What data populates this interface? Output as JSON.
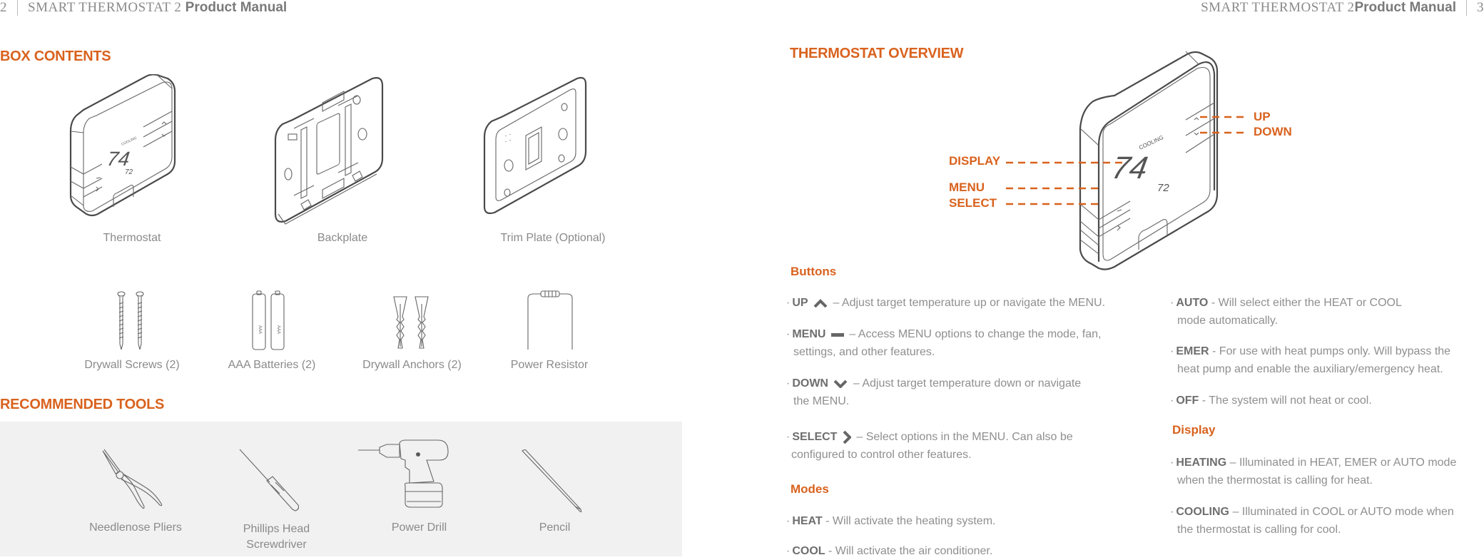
{
  "header_left": {
    "page_number": "2",
    "title_serif": "SMART THERMOSTAT 2",
    "title_bold": "Product Manual"
  },
  "header_right": {
    "title_serif": "SMART THERMOSTAT 2",
    "title_bold": "Product Manual",
    "page_number": "3"
  },
  "box_contents": {
    "title": "BOX CONTENTS",
    "items": [
      {
        "label": "Thermostat",
        "icon": "thermostat-icon"
      },
      {
        "label": "Backplate",
        "icon": "backplate-icon"
      },
      {
        "label": "Trim Plate (Optional)",
        "icon": "trim-plate-icon"
      },
      {
        "label": "Drywall Screws (2)",
        "icon": "screws-icon"
      },
      {
        "label": "AAA Batteries (2)",
        "icon": "batteries-icon"
      },
      {
        "label": "Drywall Anchors (2)",
        "icon": "anchors-icon"
      },
      {
        "label": "Power Resistor",
        "icon": "resistor-icon"
      }
    ],
    "thermostat_display": {
      "mode": "COOLING",
      "target": "74",
      "current": "72"
    },
    "battery_text": "AAA"
  },
  "recommended_tools": {
    "title": "RECOMMENDED TOOLS",
    "items": [
      {
        "label": "Needlenose Pliers",
        "icon": "pliers-icon"
      },
      {
        "label": "Phillips Head",
        "label2": "Screwdriver",
        "icon": "screwdriver-icon"
      },
      {
        "label": "Power Drill",
        "icon": "drill-icon"
      },
      {
        "label": "Pencil",
        "icon": "pencil-icon"
      }
    ]
  },
  "overview": {
    "title": "THERMOSTAT OVERVIEW",
    "callouts": {
      "display": "DISPLAY",
      "menu": "MENU",
      "select": "SELECT",
      "up": "UP",
      "down": "DOWN"
    },
    "display": {
      "mode": "COOLING",
      "target": "74",
      "current": "72"
    }
  },
  "buttons": {
    "title": "Buttons",
    "items": [
      {
        "name": "UP",
        "icon": "chevron-up-icon",
        "text": "– Adjust target temperature up or  navigate the MENU."
      },
      {
        "name": "MENU",
        "icon": "minus-icon",
        "text": "– Access MENU options to  change the mode, fan,",
        "text2": "settings, and other features."
      },
      {
        "name": "DOWN",
        "icon": "chevron-down-icon",
        "text": "– Adjust target temperature  down or navigate",
        "text2": "the MENU."
      },
      {
        "name": "SELECT",
        "icon": "chevron-right-icon",
        "text": "– Select options in the MENU. Can also be",
        "text2": "configured to control other features."
      }
    ]
  },
  "modes": {
    "title": "Modes",
    "items": [
      {
        "name": "HEAT",
        "text": "- Will activate the heating system."
      },
      {
        "name": "COOL",
        "text": "- Will activate the air conditioner."
      },
      {
        "name": "AUTO",
        "text": "- Will select either the HEAT or COOL",
        "text2": "mode automatically."
      },
      {
        "name": "EMER",
        "text": "- For use with heat pumps only. Will bypass the",
        "text2": "heat pump and enable the auxiliary/emergency heat."
      },
      {
        "name": "OFF",
        "text": "- The system will not heat or cool."
      }
    ]
  },
  "display_section": {
    "title": "Display",
    "items": [
      {
        "name": "HEATING",
        "text": "– Illuminated in HEAT, EMER or AUTO mode",
        "text2": "when the thermostat is calling for heat."
      },
      {
        "name": "COOLING",
        "text": "– Illuminated in COOL or AUTO mode when",
        "text2": "the thermostat is calling for cool."
      }
    ]
  },
  "colors": {
    "accent": "#d9621e",
    "text": "#8a8a8a",
    "bold_text": "#6e6e6e",
    "panel": "#f1f1f1"
  }
}
